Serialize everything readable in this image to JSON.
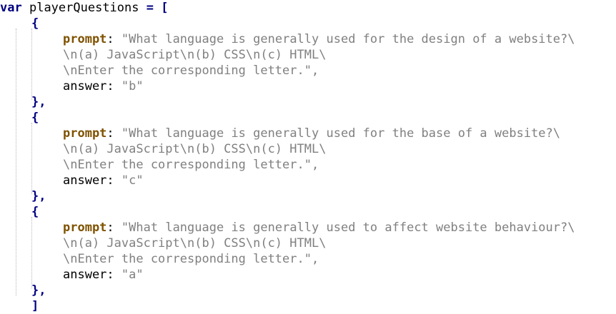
{
  "code": {
    "declaration": {
      "keyword": "var",
      "name": "playerQuestions",
      "operator": "=",
      "open_bracket": "["
    },
    "open_brace": "{",
    "close_brace": "},",
    "close_bracket": "]",
    "prop_prompt": "prompt",
    "prop_answer": "answer",
    "colon": ":",
    "questions": [
      {
        "prompt_lines": [
          "\"What language is generally used for the design of a website?\\",
          "\\n(a) JavaScript\\n(b) CSS\\n(c) HTML\\",
          "\\nEnter the corresponding letter.\","
        ],
        "answer": "\"b\""
      },
      {
        "prompt_lines": [
          "\"What language is generally used for the base of a website?\\",
          "\\n(a) JavaScript\\n(b) CSS\\n(c) HTML\\",
          "\\nEnter the corresponding letter.\","
        ],
        "answer": "\"c\""
      },
      {
        "prompt_lines": [
          "\"What language is generally used to affect website behaviour?\\",
          "\\n(a) JavaScript\\n(b) CSS\\n(c) HTML\\",
          "\\nEnter the corresponding letter.\","
        ],
        "answer": "\"a\""
      }
    ]
  }
}
